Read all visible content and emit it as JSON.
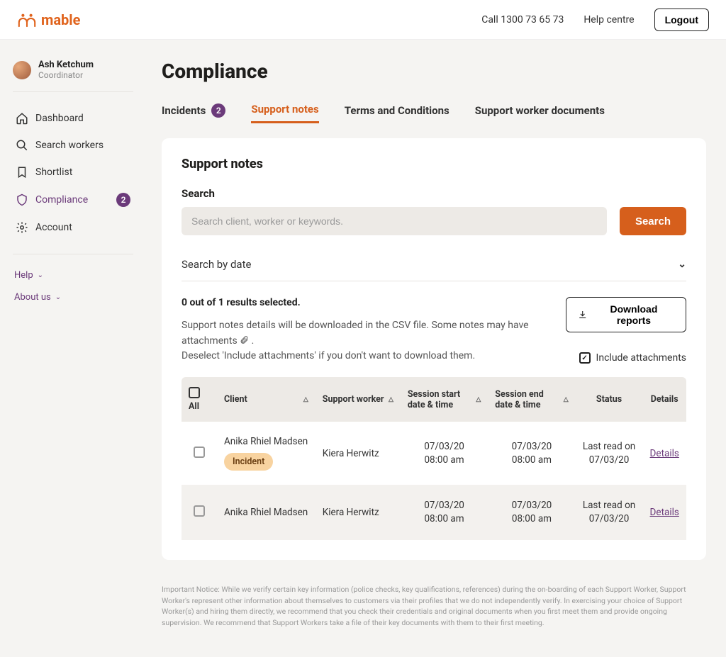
{
  "brand": {
    "name": "mable",
    "phone_label": "Call 1300 73 65 73",
    "help_label": "Help centre",
    "logout_label": "Logout"
  },
  "profile": {
    "name": "Ash Ketchum",
    "role": "Coordinator"
  },
  "nav": {
    "dashboard": "Dashboard",
    "search_workers": "Search workers",
    "shortlist": "Shortlist",
    "compliance": "Compliance",
    "compliance_badge": "2",
    "account": "Account",
    "help": "Help",
    "about": "About us"
  },
  "page": {
    "title": "Compliance"
  },
  "tabs": {
    "incidents": "Incidents",
    "incidents_badge": "2",
    "support_notes": "Support notes",
    "terms": "Terms and Conditions",
    "documents": "Support worker documents"
  },
  "panel": {
    "title": "Support notes",
    "search_label": "Search",
    "search_placeholder": "Search client, worker or keywords.",
    "search_button": "Search",
    "accordion_label": "Search by date",
    "selection_text": "0 out of 1 results selected.",
    "download_button": "Download reports",
    "help_line1": "Support notes details will be downloaded in the CSV file. Some notes may have attachments",
    "help_line2": "Deselect 'Include attachments' if you don't want to download them.",
    "include_label": "Include attachments"
  },
  "table": {
    "headers": {
      "all": "All",
      "client": "Client",
      "worker": "Support worker",
      "start": "Session start date & time",
      "end": "Session end date & time",
      "status": "Status",
      "details": "Details"
    },
    "rows": [
      {
        "client": "Anika Rhiel Madsen",
        "incident": "Incident",
        "worker": "Kiera Herwitz",
        "start_date": "07/03/20",
        "start_time": "08:00 am",
        "end_date": "07/03/20",
        "end_time": "08:00 am",
        "status_line1": "Last read on",
        "status_line2": "07/03/20",
        "details": "Details"
      },
      {
        "client": "Anika Rhiel Madsen",
        "incident": "",
        "worker": "Kiera Herwitz",
        "start_date": "07/03/20",
        "start_time": "08:00 am",
        "end_date": "07/03/20",
        "end_time": "08:00 am",
        "status_line1": "Last read on",
        "status_line2": "07/03/20",
        "details": "Details"
      }
    ]
  },
  "notice": "Important Notice: While we verify certain key information (police checks, key qualifications, references) during the on-boarding of each Support Worker, Support Worker's represent other information about themselves to customers via their profiles that we do not independently verify. In exercising your choice of Support Worker(s) and hiring them directly, we recommend that you check their credentials and original documents when you first meet them and provide ongoing supervision. We recommend that Support Workers take a file of their key documents with them to their first meeting."
}
